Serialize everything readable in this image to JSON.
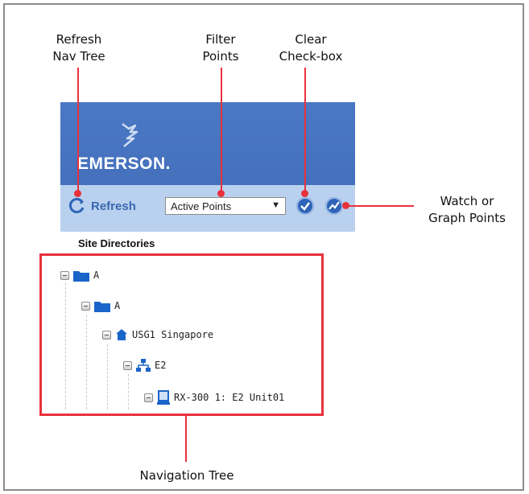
{
  "callouts": {
    "refresh": "Refresh\nNav Tree",
    "filter": "Filter\nPoints",
    "clear": "Clear\nCheck-box",
    "watch": "Watch or\nGraph Points",
    "tree": "Navigation Tree"
  },
  "app": {
    "logo": "EMERSON.",
    "toolbar": {
      "refresh_label": "Refresh",
      "filter_value": "Active Points",
      "clear_icon": "checkmark-circle-icon",
      "watch_icon": "graph-circle-icon"
    },
    "site_directories_label": "Site Directories",
    "tree": [
      {
        "label": "A",
        "icon": "folder-icon"
      },
      {
        "label": "A",
        "icon": "folder-icon"
      },
      {
        "label": "USG1 Singapore",
        "icon": "site-house-icon"
      },
      {
        "label": "E2",
        "icon": "network-controller-icon"
      },
      {
        "label": "RX-300 1: E2 Unit01",
        "icon": "device-icon"
      }
    ]
  },
  "colors": {
    "accent_red": "#e8313b",
    "header_blue": "#4470bc",
    "toolbar_blue": "#b9d1ee"
  }
}
